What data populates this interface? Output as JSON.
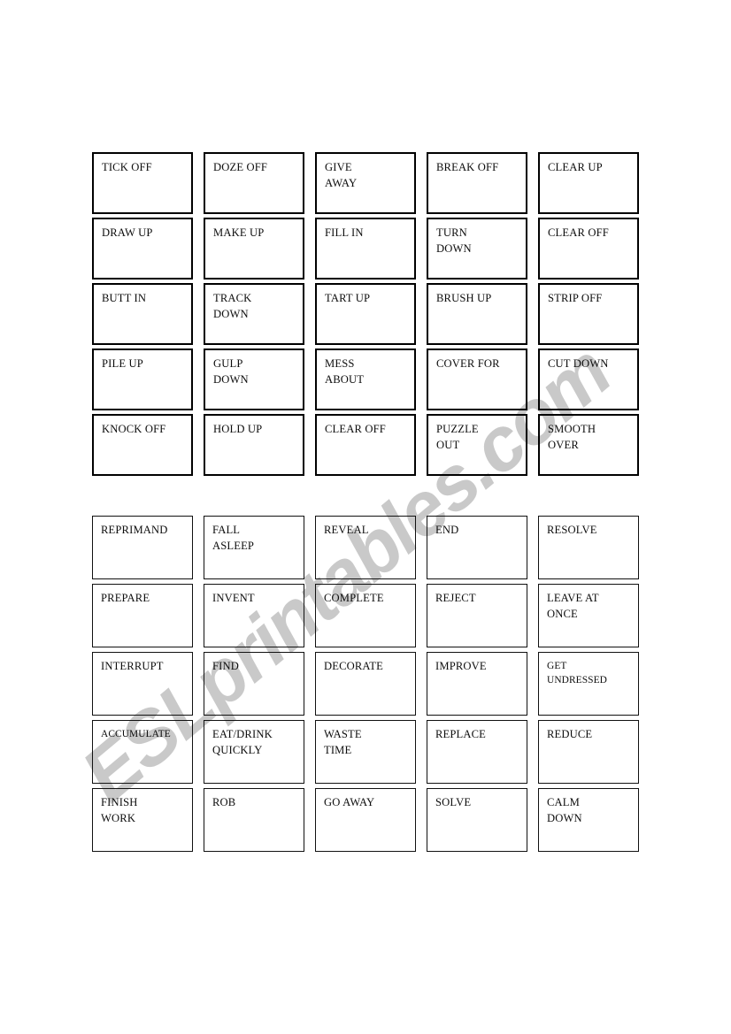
{
  "document": {
    "kind": "esl-worksheet",
    "background_color": "#ffffff"
  },
  "watermark": {
    "text": "ESLprintables.com",
    "color": "#c9c9c9",
    "rotation_deg": -40
  },
  "grids": [
    {
      "id": "phrasal-verbs",
      "name": "phrasal-verb-cards",
      "columns": 5,
      "rows": 5,
      "border_color": "#000000",
      "cards": [
        {
          "text": "TICK OFF"
        },
        {
          "text": "DOZE OFF"
        },
        {
          "text": "GIVE\nAWAY"
        },
        {
          "text": "BREAK OFF"
        },
        {
          "text": "CLEAR UP"
        },
        {
          "text": "DRAW UP"
        },
        {
          "text": "MAKE UP"
        },
        {
          "text": "FILL IN"
        },
        {
          "text": "TURN\nDOWN"
        },
        {
          "text": "CLEAR OFF"
        },
        {
          "text": "BUTT IN"
        },
        {
          "text": "TRACK\nDOWN"
        },
        {
          "text": "TART UP"
        },
        {
          "text": "BRUSH UP"
        },
        {
          "text": "STRIP OFF"
        },
        {
          "text": "PILE UP"
        },
        {
          "text": "GULP\nDOWN"
        },
        {
          "text": "MESS\nABOUT"
        },
        {
          "text": "COVER FOR"
        },
        {
          "text": "CUT DOWN"
        },
        {
          "text": "KNOCK OFF"
        },
        {
          "text": "HOLD UP"
        },
        {
          "text": "CLEAR OFF"
        },
        {
          "text": "PUZZLE\nOUT"
        },
        {
          "text": "SMOOTH\nOVER"
        }
      ]
    },
    {
      "id": "definitions",
      "name": "definition-cards",
      "columns": 5,
      "rows": 5,
      "border_color": "#111111",
      "cards": [
        {
          "text": "REPRIMAND"
        },
        {
          "text": "FALL\nASLEEP"
        },
        {
          "text": "REVEAL"
        },
        {
          "text": "END"
        },
        {
          "text": "RESOLVE"
        },
        {
          "text": "PREPARE"
        },
        {
          "text": "INVENT"
        },
        {
          "text": "COMPLETE"
        },
        {
          "text": "REJECT"
        },
        {
          "text": "LEAVE AT\nONCE"
        },
        {
          "text": "INTERRUPT"
        },
        {
          "text": "FIND"
        },
        {
          "text": "DECORATE"
        },
        {
          "text": "IMPROVE"
        },
        {
          "text": "GET\nUNDRESSED",
          "small": true
        },
        {
          "text": "ACCUMULATE",
          "small": true
        },
        {
          "text": "EAT/DRINK\nQUICKLY"
        },
        {
          "text": "WASTE\nTIME"
        },
        {
          "text": "REPLACE"
        },
        {
          "text": "REDUCE"
        },
        {
          "text": "FINISH\nWORK"
        },
        {
          "text": "ROB"
        },
        {
          "text": "GO AWAY"
        },
        {
          "text": "SOLVE"
        },
        {
          "text": "CALM\nDOWN"
        }
      ]
    }
  ]
}
